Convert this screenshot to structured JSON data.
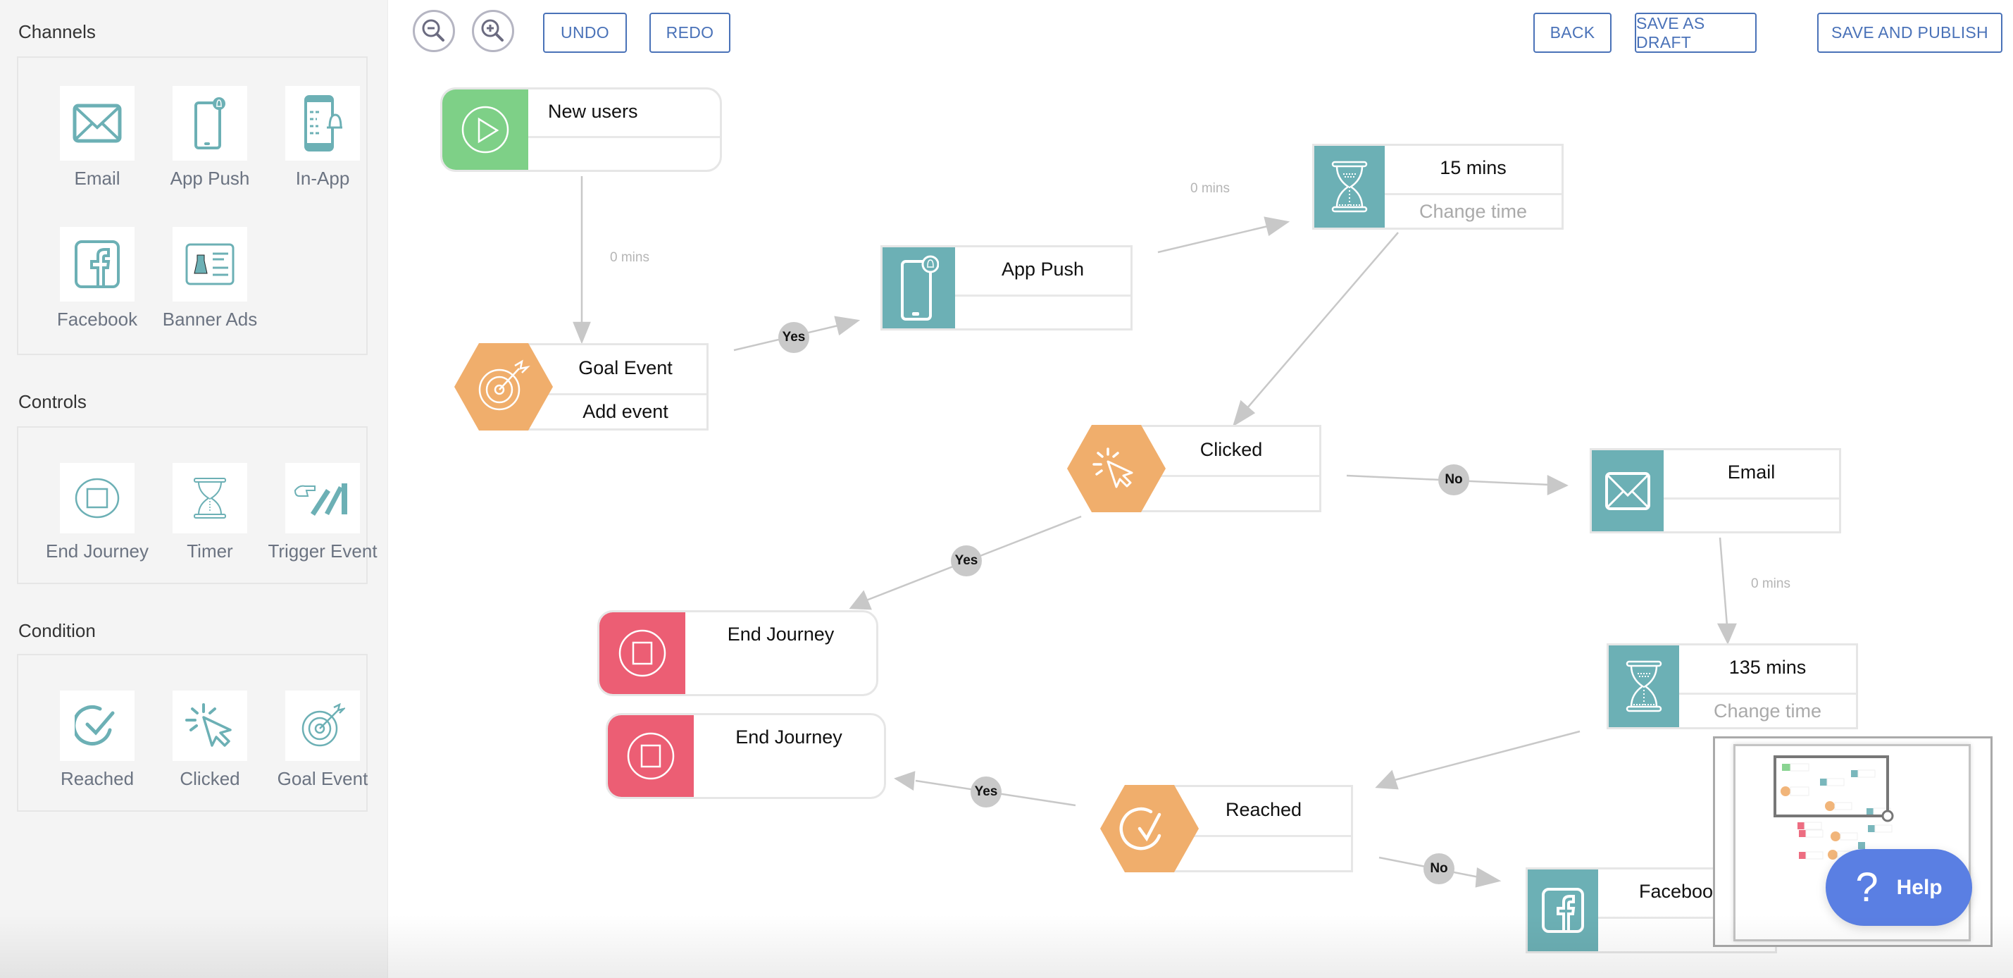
{
  "sidebar": {
    "sections": [
      {
        "title": "Channels",
        "items": [
          {
            "label": "Email",
            "icon": "envelope-icon"
          },
          {
            "label": "App Push",
            "icon": "mobile-notification-icon"
          },
          {
            "label": "In-App",
            "icon": "in-app-message-icon"
          },
          {
            "label": "Facebook",
            "icon": "facebook-icon"
          },
          {
            "label": "Banner Ads",
            "icon": "banner-ad-icon"
          }
        ]
      },
      {
        "title": "Controls",
        "items": [
          {
            "label": "End Journey",
            "icon": "stop-circle-icon"
          },
          {
            "label": "Timer",
            "icon": "hourglass-icon"
          },
          {
            "label": "Trigger Event",
            "icon": "domino-trigger-icon"
          }
        ]
      },
      {
        "title": "Condition",
        "items": [
          {
            "label": "Reached",
            "icon": "check-circle-icon"
          },
          {
            "label": "Clicked",
            "icon": "cursor-click-icon"
          },
          {
            "label": "Goal Event",
            "icon": "target-icon"
          }
        ]
      }
    ]
  },
  "toolbar": {
    "zoom_out": "zoom-out",
    "zoom_in": "zoom-in",
    "undo": "UNDO",
    "redo": "REDO",
    "back": "BACK",
    "save_draft": "SAVE AS DRAFT",
    "save_publish": "SAVE AND PUBLISH"
  },
  "colors": {
    "accent": "#4a72b8",
    "start": "#7ed087",
    "condition": "#f0ae6c",
    "channel": "#6cb0b5",
    "end": "#ec5e74",
    "help": "#5a7fe3",
    "edge": "#c8c8c8"
  },
  "flow": {
    "nodes": {
      "new_users": {
        "title": "New users",
        "sub": ""
      },
      "goal_event": {
        "title": "Goal Event",
        "sub": "Add event"
      },
      "app_push": {
        "title": "App Push",
        "sub": ""
      },
      "timer_15": {
        "title": "15 mins",
        "sub": "Change time"
      },
      "clicked": {
        "title": "Clicked",
        "sub": ""
      },
      "email": {
        "title": "Email",
        "sub": ""
      },
      "end_journey_1": {
        "title": "End Journey",
        "sub": ""
      },
      "end_journey_2": {
        "title": "End Journey",
        "sub": ""
      },
      "timer_135": {
        "title": "135 mins",
        "sub": "Change time"
      },
      "reached": {
        "title": "Reached",
        "sub": ""
      },
      "facebook": {
        "title": "Facebook",
        "sub": ""
      }
    },
    "edge_labels": {
      "new_users_to_goal": "0 mins",
      "app_push_to_timer": "0 mins",
      "email_to_timer": "0 mins"
    },
    "badges": {
      "goal_yes": "Yes",
      "clicked_no": "No",
      "clicked_yes": "Yes",
      "reached_yes": "Yes",
      "reached_no": "No"
    }
  },
  "help": {
    "label": "Help",
    "icon_glyph": "?"
  }
}
